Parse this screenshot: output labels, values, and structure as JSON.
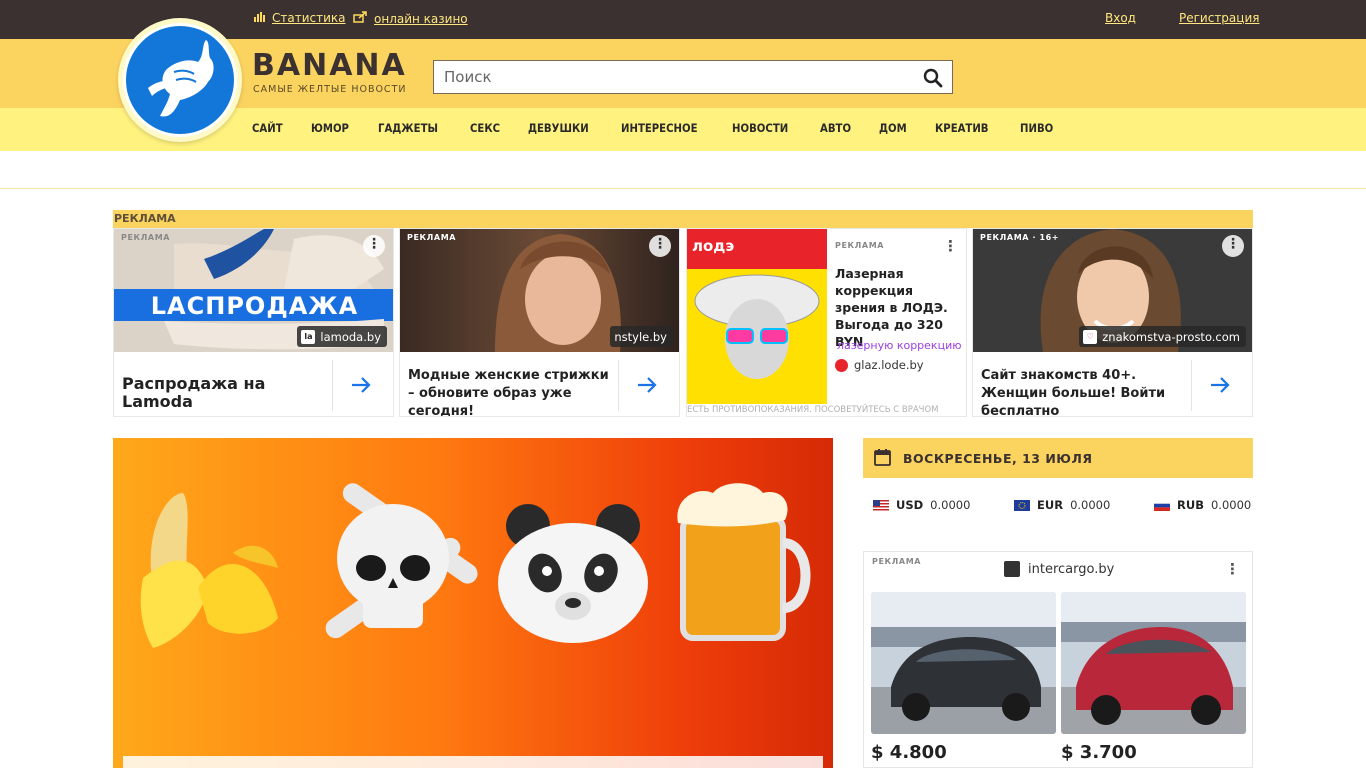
{
  "topbar": {
    "stats_label": "Статистика",
    "casino_label": "онлайн казино",
    "login_label": "Вход",
    "register_label": "Регистрация"
  },
  "brand": {
    "name": "BANANA",
    "tagline": "САМЫЕ ЖЕЛТЫЕ НОВОСТИ"
  },
  "search": {
    "placeholder": "Поиск"
  },
  "nav": [
    "САЙТ",
    "ЮМОР",
    "ГАДЖЕТЫ",
    "СЕКС",
    "ДЕВУШКИ",
    "ИНТЕРЕСНОЕ",
    "НОВОСТИ",
    "АВТО",
    "ДОМ",
    "КРЕАТИВ",
    "ПИВО"
  ],
  "ads": {
    "section_label": "РЕКЛАМА",
    "items": [
      {
        "tag": "РЕКЛАМА",
        "banner_text": "LAСПРОДАЖА",
        "source": "lamoda.by",
        "source_icon": "la",
        "title": "Распродажа на Lamoda"
      },
      {
        "tag": "РЕКЛАМА",
        "source": "nstyle.by",
        "title": "Модные женские стрижки – обновите образ уже сегодня!"
      },
      {
        "tag": "РЕКЛАМА",
        "brand_text": "лодэ",
        "title": "Лазерная коррекция зрения в ЛОДЭ. Выгода до 320 BYN",
        "subtitle": "лазерную коррекцию",
        "source": "glaz.lode.by",
        "disclaimer": "ЕСТЬ ПРОТИВОПОКАЗАНИЯ. ПОСОВЕТУЙТЕСЬ С ВРАЧОМ"
      },
      {
        "tag": "РЕКЛАМА · 16+",
        "source": "znakomstva-prosto.com",
        "title": "Сайт знакомств 40+. Женщин больше! Войти бесплатно"
      }
    ]
  },
  "sidebar": {
    "date": "ВОСКРЕСЕНЬЕ, 13 ИЮЛЯ",
    "rates": [
      {
        "code": "USD",
        "value": "0.0000"
      },
      {
        "code": "EUR",
        "value": "0.0000"
      },
      {
        "code": "RUB",
        "value": "0.0000"
      }
    ],
    "ad": {
      "tag": "РЕКЛАМА",
      "source": "intercargo.by",
      "prices": [
        "$ 4.800",
        "$ 3.700"
      ]
    }
  },
  "icons": {
    "stats": "bar-chart-icon",
    "casino": "share-icon",
    "search": "search-icon",
    "calendar": "calendar-icon",
    "arrow": "arrow-right-icon",
    "menu": "more-vertical-icon"
  },
  "colors": {
    "topbar": "#3a3130",
    "header": "#fbd35f",
    "nav": "#fff27e",
    "accent_blue": "#1277d8"
  }
}
